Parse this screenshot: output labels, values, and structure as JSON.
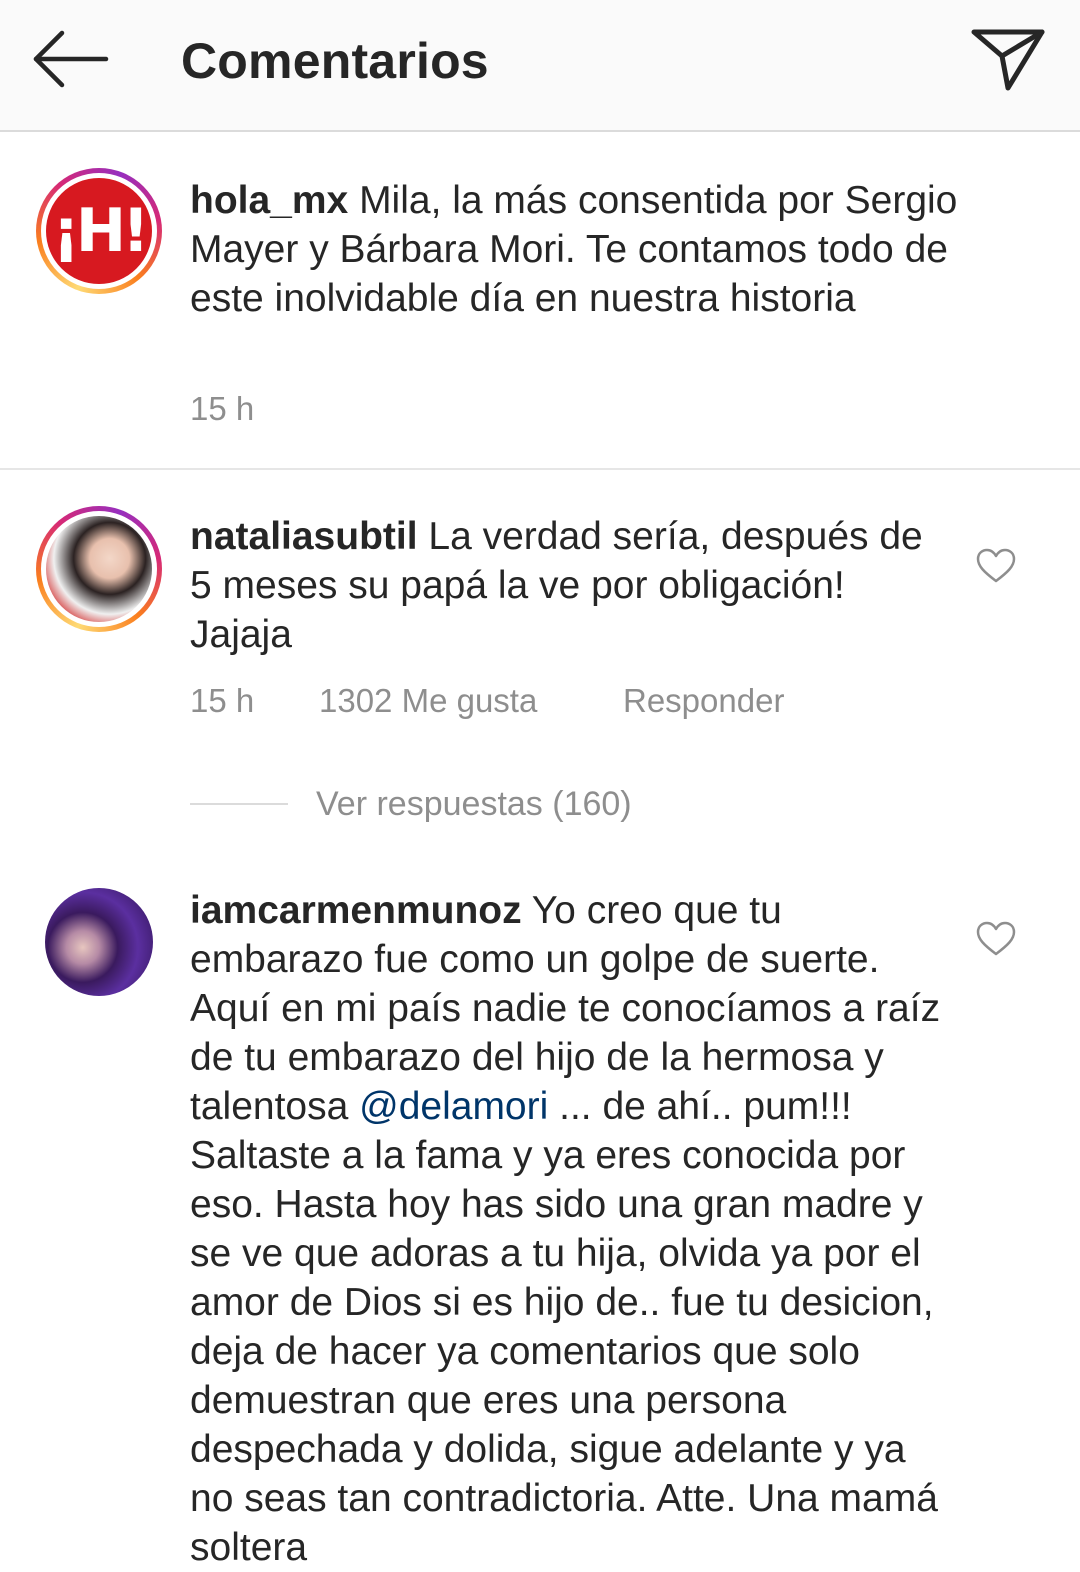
{
  "header": {
    "title": "Comentarios",
    "back_icon": "arrow-left-icon",
    "share_icon": "paper-plane-icon"
  },
  "caption": {
    "username": "hola_mx",
    "text": " Mila, la más consentida por Sergio Mayer y Bárbara Mori. Te contamos todo de este inolvidable día en nuestra historia",
    "time": "15 h",
    "avatar_text": "¡H!"
  },
  "comments": [
    {
      "username": "nataliasubtil",
      "text": " La verdad sería, después de 5 meses su papá la ve por obligación! Jajaja",
      "time": "15 h",
      "likes": "1302 Me gusta",
      "reply": "Responder",
      "view_replies": "Ver respuestas (160)"
    },
    {
      "username": "iamcarmenmunoz",
      "text_before": " Yo creo que tu embarazo fue como un golpe de suerte. Aquí en mi país nadie te conocíamos a raíz de tu embarazo del hijo de la hermosa y talentosa ",
      "mention": "@delamori",
      "text_after": " ... de ahí.. pum!!! Saltaste a la fama y ya eres conocida por eso. Hasta hoy has sido una gran madre y se ve que adoras a tu hija, olvida ya por el amor de Dios si es hijo de.. fue tu desicion, deja de hacer ya comentarios que solo demuestran que eres una persona despechada y dolida, sigue adelante y ya no seas tan contradictoria. Atte. Una mamá soltera"
    }
  ],
  "colors": {
    "header_bg": "#fafafa",
    "text": "#262626",
    "meta": "#8e8e8e",
    "mention": "#003569",
    "divider": "#dbdbdb"
  }
}
